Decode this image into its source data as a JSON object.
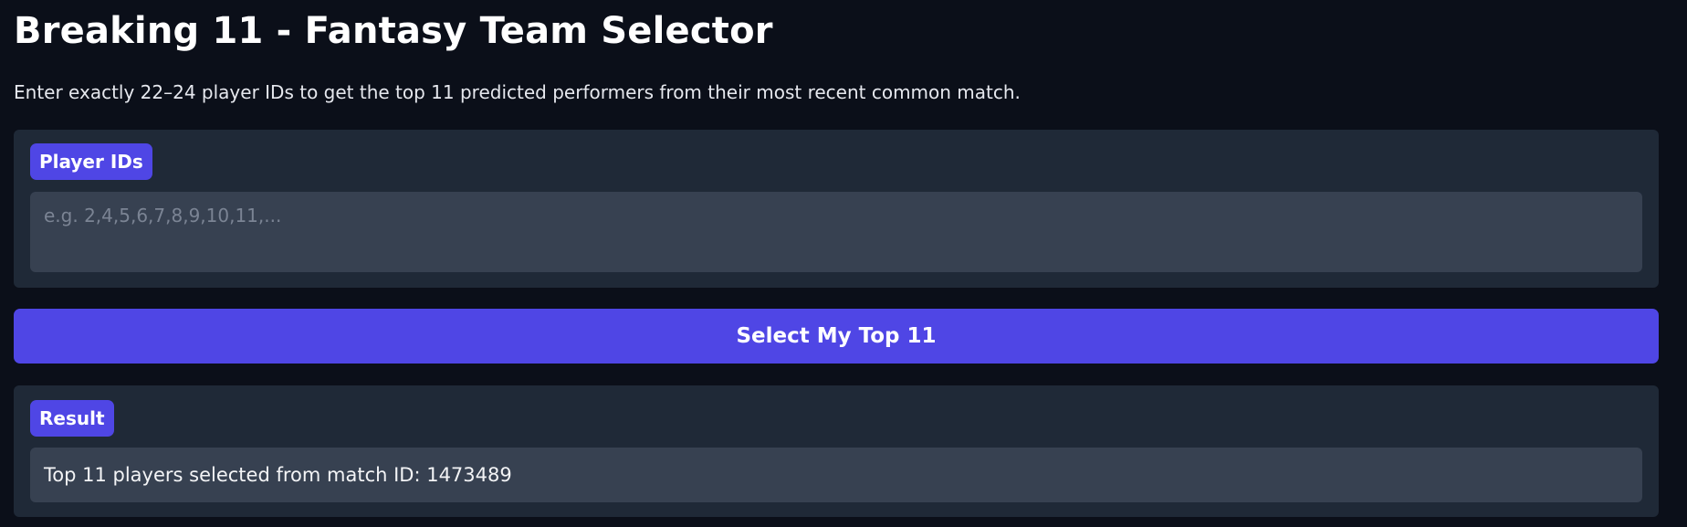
{
  "header": {
    "title": "Breaking 11 - Fantasy Team Selector",
    "subtitle": "Enter exactly 22–24 player IDs to get the top 11 predicted performers from their most recent common match."
  },
  "input_panel": {
    "label": "Player IDs",
    "placeholder": "e.g. 2,4,5,6,7,8,9,10,11,...",
    "value": ""
  },
  "submit_button": {
    "label": "Select My Top 11"
  },
  "result_panel": {
    "label": "Result",
    "text": "Top 11 players selected from match ID: 1473489"
  },
  "colors": {
    "background": "#0b0f19",
    "panel": "#1f2937",
    "field": "#374151",
    "accent": "#4f46e5"
  }
}
